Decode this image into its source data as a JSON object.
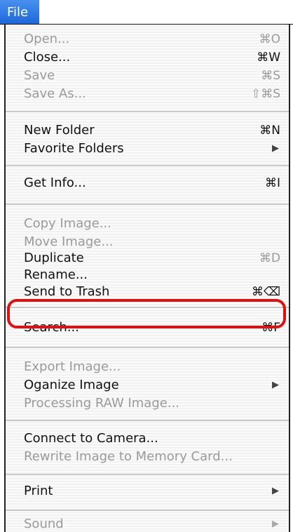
{
  "menubar": {
    "title": "File"
  },
  "menu": {
    "groups": [
      {
        "items": [
          {
            "label": "Open...",
            "shortcut": "⌘O",
            "enabled": false
          },
          {
            "label": "Close...",
            "shortcut": "⌘W",
            "enabled": true
          },
          {
            "label": "Save",
            "shortcut": "⌘S",
            "enabled": false
          },
          {
            "label": "Save As...",
            "shortcut": "⇧⌘S",
            "enabled": false
          }
        ]
      },
      {
        "items": [
          {
            "label": "New Folder",
            "shortcut": "⌘N",
            "enabled": true
          },
          {
            "label": "Favorite Folders",
            "submenu": "▶",
            "enabled": true
          }
        ]
      },
      {
        "items": [
          {
            "label": "Get Info...",
            "shortcut": "⌘I",
            "enabled": true
          }
        ]
      },
      {
        "items": [
          {
            "label": "Copy Image...",
            "enabled": false
          },
          {
            "label": "Move Image...",
            "enabled": false
          },
          {
            "label": "Duplicate",
            "shortcut": "⌘D",
            "enabled": true,
            "shortcut_enabled": false
          },
          {
            "label": "Rename...",
            "enabled": true,
            "highlighted": true
          },
          {
            "label": "Send to Trash",
            "shortcut": "⌘⌫",
            "enabled": true
          }
        ]
      },
      {
        "items": [
          {
            "label": "Search...",
            "shortcut": "⌘F",
            "enabled": true
          }
        ]
      },
      {
        "items": [
          {
            "label": "Export Image...",
            "enabled": false
          },
          {
            "label": "Oganize Image",
            "submenu": "▶",
            "enabled": true
          },
          {
            "label": "Processing RAW Image...",
            "enabled": false
          }
        ]
      },
      {
        "items": [
          {
            "label": "Connect to Camera...",
            "enabled": true
          },
          {
            "label": "Rewrite Image to Memory Card...",
            "enabled": false
          }
        ]
      },
      {
        "items": [
          {
            "label": "Print",
            "submenu": "▶",
            "enabled": true
          }
        ]
      },
      {
        "items": [
          {
            "label": "Sound",
            "submenu": "▶",
            "enabled": false
          }
        ]
      }
    ]
  },
  "colors": {
    "menubar_title_bg": "#1a67d9",
    "highlight_outline": "#e01010",
    "disabled_text": "#9a9a9a"
  }
}
